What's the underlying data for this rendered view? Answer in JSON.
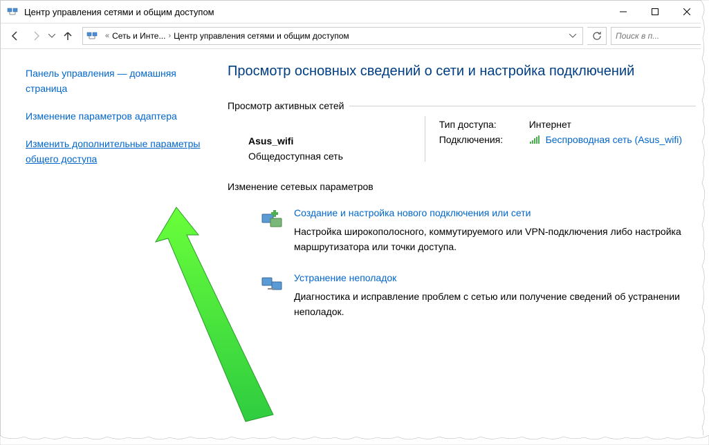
{
  "titlebar": {
    "title": "Центр управления сетями и общим доступом"
  },
  "navbar": {
    "breadcrumb1": "Сеть и Инте...",
    "breadcrumb2": "Центр управления сетями и общим доступом"
  },
  "search": {
    "placeholder": "Поиск в п..."
  },
  "sidebar": {
    "link1": "Панель управления — домашняя страница",
    "link2": "Изменение параметров адаптера",
    "link3": "Изменить дополнительные параметры общего доступа"
  },
  "content": {
    "page_title": "Просмотр основных сведений о сети и настройка подключений",
    "active_networks_label": "Просмотр активных сетей",
    "network": {
      "name": "Asus_wifi",
      "type": "Общедоступная сеть",
      "access_label": "Тип доступа:",
      "access_value": "Интернет",
      "connections_label": "Подключения:",
      "connection_link": "Беспроводная сеть (Asus_wifi)"
    },
    "change_settings_label": "Изменение сетевых параметров",
    "action1": {
      "link": "Создание и настройка нового подключения или сети",
      "desc": "Настройка широкополосного, коммутируемого или VPN-подключения либо настройка маршрутизатора или точки доступа."
    },
    "action2": {
      "link": "Устранение неполадок",
      "desc": "Диагностика и исправление проблем с сетью или получение сведений об устранении неполадок."
    }
  }
}
